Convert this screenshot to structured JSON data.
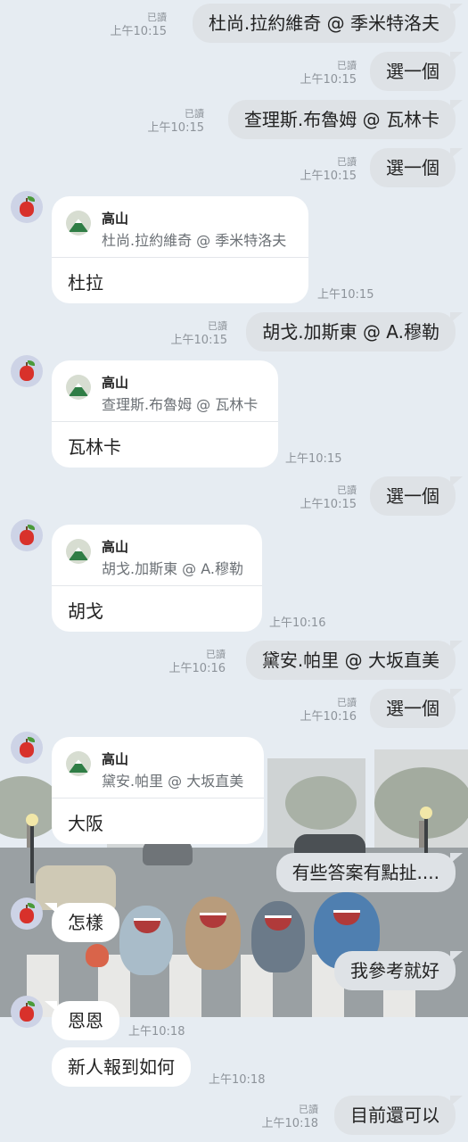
{
  "chat": {
    "read_label": "已讀",
    "sender_name": "高山",
    "messages": [
      {
        "text": "杜尚.拉約維奇 @ 季米特洛夫",
        "time": "上午10:15"
      },
      {
        "text": "選一個",
        "time": "上午10:15"
      },
      {
        "text": "查理斯.布魯姆 @ 瓦林卡",
        "time": "上午10:15"
      },
      {
        "text": "選一個",
        "time": "上午10:15"
      },
      {
        "quote": "杜尚.拉約維奇 @ 季米特洛夫",
        "text": "杜拉",
        "time": "上午10:15"
      },
      {
        "text": "胡戈.加斯東 @ A.穆勒",
        "time": "上午10:15"
      },
      {
        "quote": "查理斯.布魯姆 @ 瓦林卡",
        "text": "瓦林卡",
        "time": "上午10:15"
      },
      {
        "text": "選一個",
        "time": "上午10:15"
      },
      {
        "quote": "胡戈.加斯東 @ A.穆勒",
        "text": "胡戈",
        "time": "上午10:16"
      },
      {
        "text": "黛安.帕里 @ 大坂直美",
        "time": "上午10:16"
      },
      {
        "text": "選一個",
        "time": "上午10:16"
      },
      {
        "quote": "黛安.帕里 @ 大坂直美",
        "text": "大阪"
      },
      {
        "text": "有些答案有點扯...."
      },
      {
        "text": "怎樣"
      },
      {
        "text": "我參考就好"
      },
      {
        "text": "恩恩",
        "time": "上午10:18"
      },
      {
        "text": "新人報到如何",
        "time": "上午10:18"
      },
      {
        "text": "目前還可以",
        "time": "上午10:18"
      }
    ]
  }
}
